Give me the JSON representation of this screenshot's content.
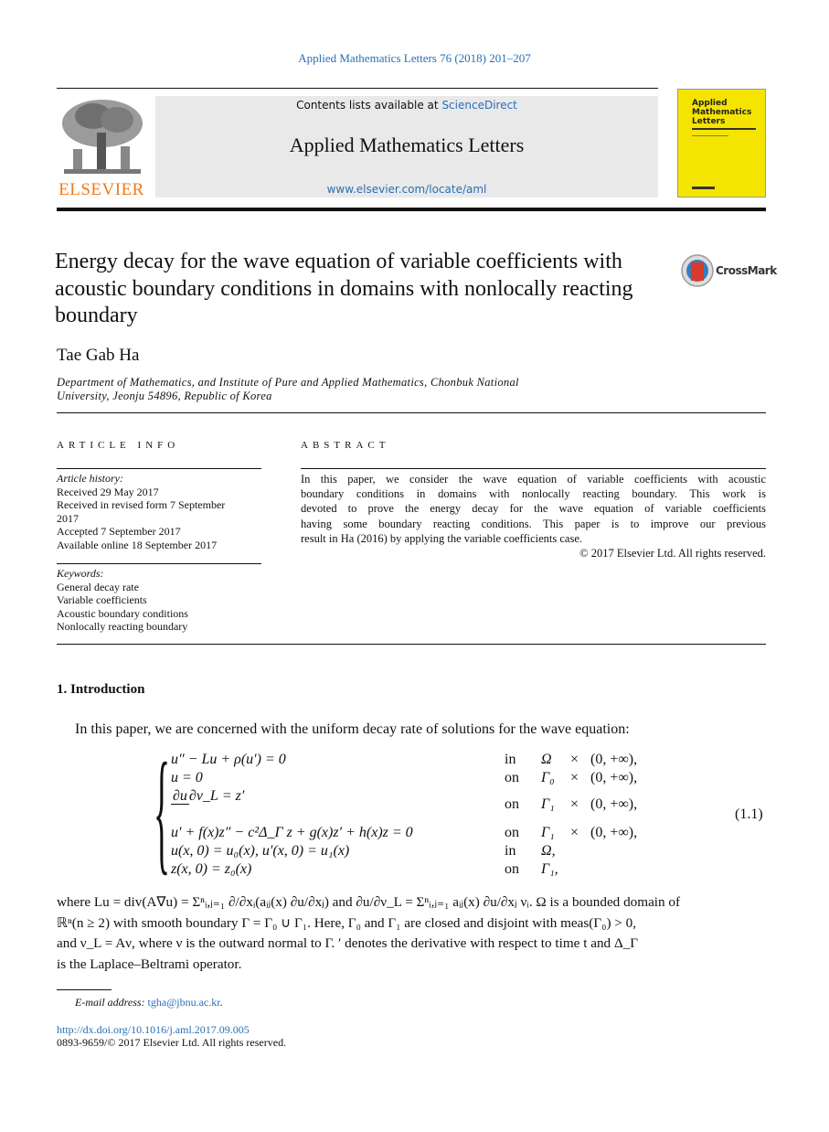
{
  "header": {
    "citation": "Applied Mathematics Letters 76 (2018) 201–207",
    "contents_prefix": "Contents lists available at ",
    "sciencedirect": "ScienceDirect",
    "journal_title": "Applied Mathematics Letters",
    "journal_url": "www.elsevier.com/locate/aml",
    "publisher_logo": "ELSEVIER",
    "cover_title": "Applied Mathematics Letters"
  },
  "article": {
    "title_lines": [
      "Energy decay for the wave equation of variable coefficients with",
      "acoustic boundary conditions in domains with nonlocally reacting",
      "boundary"
    ],
    "crossmark": "CrossMark",
    "author": "Tae Gab Ha",
    "affiliation_lines": [
      "Department of Mathematics, and Institute of Pure and Applied Mathematics, Chonbuk National",
      "University, Jeonju 54896, Republic of Korea"
    ]
  },
  "info": {
    "heading": "ARTICLE INFO",
    "history_label": "Article history:",
    "history": [
      "Received 29 May 2017",
      "Received in revised form 7 September",
      "2017",
      "Accepted 7 September 2017",
      "Available online 18 September 2017"
    ],
    "keywords_label": "Keywords:",
    "keywords": [
      "General decay rate",
      "Variable coefficients",
      "Acoustic boundary conditions",
      "Nonlocally reacting boundary"
    ]
  },
  "abstract": {
    "heading": "ABSTRACT",
    "lines": [
      "In this paper, we consider the wave equation of variable coefficients with acoustic",
      "boundary conditions in domains with nonlocally reacting boundary. This work is",
      "devoted to prove the energy decay for the wave equation of variable coefficients",
      "having some boundary reacting conditions. This paper is to improve our previous",
      "result in Ha (2016) by applying the variable coefficients case."
    ],
    "copyright": "© 2017 Elsevier Ltd. All rights reserved."
  },
  "section": {
    "heading": "1.  Introduction",
    "intro": "In this paper, we are concerned with the uniform decay rate of solutions for the wave equation:",
    "equation_number": "(1.1)",
    "equation_rows": [
      {
        "lhs": "u″ − Lu + ρ(u′) = 0",
        "where": "in",
        "set": "Ω",
        "times": "×",
        "interval": "(0, +∞),"
      },
      {
        "lhs": "u = 0",
        "where": "on",
        "set": "Γ₀",
        "times": "×",
        "interval": "(0, +∞),"
      },
      {
        "lhs_num": "∂u",
        "lhs_den": "∂ν_L",
        "lhs_rest": " = z′",
        "where": "on",
        "set": "Γ₁",
        "times": "×",
        "interval": "(0, +∞),"
      },
      {
        "lhs": "u′ + f(x)z″ − c²Δ_Γ z + g(x)z′ + h(x)z = 0",
        "where": "on",
        "set": "Γ₁",
        "times": "×",
        "interval": "(0, +∞),"
      },
      {
        "lhs": "u(x, 0) = u₀(x),      u′(x, 0) = u₁(x)",
        "where": "in",
        "set": "Ω,",
        "times": "",
        "interval": ""
      },
      {
        "lhs": "z(x, 0) = z₀(x)",
        "where": "on",
        "set": "Γ₁,",
        "times": "",
        "interval": ""
      }
    ],
    "after_lines": [
      "where Lu = div(A∇u) = Σⁿᵢ,ⱼ₌₁ ∂/∂xᵢ(aᵢⱼ(x) ∂u/∂xⱼ) and ∂u/∂ν_L = Σⁿᵢ,ⱼ₌₁ aᵢⱼ(x) ∂u/∂xⱼ νᵢ. Ω is a bounded domain of",
      "ℝⁿ(n ≥ 2) with smooth boundary Γ = Γ₀ ∪ Γ₁. Here, Γ₀ and Γ₁ are closed and disjoint with meas(Γ₀) > 0,",
      "and ν_L = Aν, where ν is the outward normal to Γ. ′ denotes the derivative with respect to time t and Δ_Γ",
      "is the Laplace–Beltrami operator."
    ]
  },
  "footer": {
    "email_label": "E-mail address: ",
    "email": "tgha@jbnu.ac.kr",
    "email_end": ".",
    "doi": "http://dx.doi.org/10.1016/j.aml.2017.09.005",
    "issn": "0893-9659/© 2017 Elsevier Ltd. All rights reserved."
  },
  "colors": {
    "link": "#2a6fb5",
    "elsevier": "#f07a1a",
    "cover": "#f4e400"
  }
}
